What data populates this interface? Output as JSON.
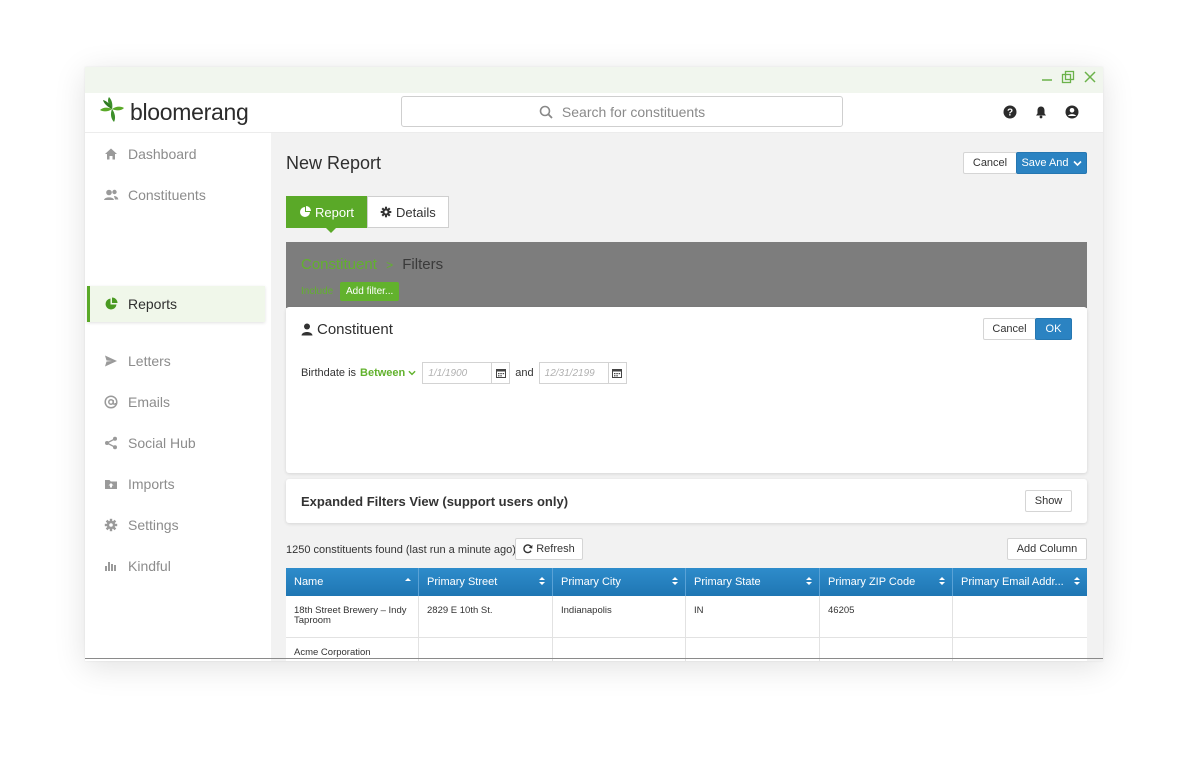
{
  "app": {
    "brand": "bloomerang",
    "search_placeholder": "Search for constituents",
    "colors": {
      "brand_green": "#5aa928",
      "primary_blue": "#2b83c2",
      "filter_bar_gray": "#7d7d7d"
    }
  },
  "sidebar": {
    "items": [
      {
        "label": "Dashboard",
        "icon": "home-icon"
      },
      {
        "label": "Constituents",
        "icon": "users-icon"
      },
      {
        "label": "Reports",
        "icon": "pie-chart-icon",
        "active": true
      },
      {
        "label": "Letters",
        "icon": "paper-plane-icon"
      },
      {
        "label": "Emails",
        "icon": "at-icon"
      },
      {
        "label": "Social Hub",
        "icon": "share-icon"
      },
      {
        "label": "Imports",
        "icon": "folder-upload-icon"
      },
      {
        "label": "Settings",
        "icon": "gear-icon"
      },
      {
        "label": "Kindful",
        "icon": "kindful-bars-icon"
      }
    ]
  },
  "page": {
    "title": "New Report",
    "cancel_label": "Cancel",
    "save_label": "Save And",
    "tabs": [
      {
        "label": "Report",
        "icon": "pie-chart-icon",
        "active": true
      },
      {
        "label": "Details",
        "icon": "gear-icon"
      }
    ]
  },
  "filter_bar": {
    "crumb_primary": "Constituent",
    "crumb_separator": ">",
    "crumb_secondary": "Filters",
    "include_label": "Include",
    "add_filter_label": "Add filter..."
  },
  "constituent_card": {
    "title": "Constituent",
    "cancel_label": "Cancel",
    "ok_label": "OK",
    "field_label": "Birthdate is",
    "operator": "Between",
    "from_placeholder": "1/1/1900",
    "and_label": "and",
    "to_placeholder": "12/31/2199"
  },
  "expanded": {
    "title": "Expanded Filters View (support users only)",
    "show_label": "Show"
  },
  "results": {
    "found_text": "1250 constituents found (last run a minute ago)",
    "refresh_label": "Refresh",
    "add_column_label": "Add Column"
  },
  "table": {
    "columns": [
      "Name",
      "Primary Street",
      "Primary City",
      "Primary State",
      "Primary ZIP Code",
      "Primary Email Addr..."
    ],
    "rows": [
      [
        "18th Street Brewery – Indy Taproom",
        "2829 E 10th St.",
        "Indianapolis",
        "IN",
        "46205",
        ""
      ],
      [
        "Acme Corporation",
        "",
        "",
        "",
        "",
        ""
      ]
    ]
  }
}
